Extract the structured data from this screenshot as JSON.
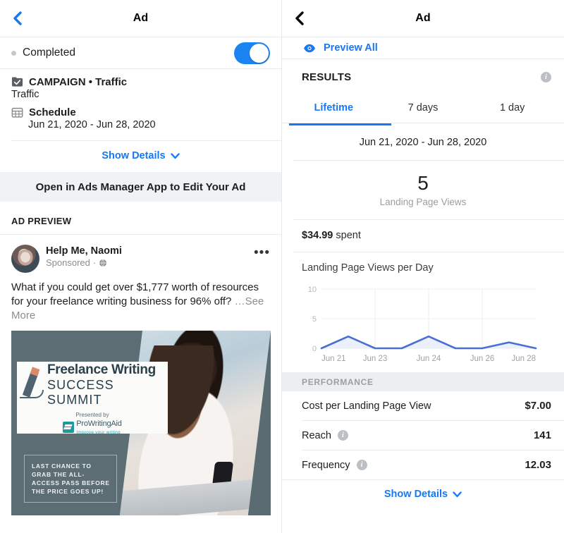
{
  "left": {
    "nav": {
      "title": "Ad",
      "back_icon": "chevron-left-icon"
    },
    "status": {
      "label": "Completed",
      "toggle_on": true,
      "dot_color": "#c4c7cc",
      "toggle_color": "#1b84f3"
    },
    "campaign": {
      "icon": "clipboard-check-icon",
      "title": "CAMPAIGN • Traffic",
      "subtitle": "Traffic"
    },
    "schedule": {
      "icon": "calendar-icon",
      "title": "Schedule",
      "value": "Jun 21, 2020 - Jun 28, 2020"
    },
    "show_details": "Show Details",
    "cta": "Open in Ads Manager App to Edit Your Ad",
    "ad_preview_label": "AD PREVIEW",
    "ad": {
      "page_name": "Help Me, Naomi",
      "sponsored": "Sponsored",
      "globe_icon": "globe-icon",
      "menu_icon": "ellipsis-icon",
      "body": "What if you could get over $1,777 worth of resources for your freelance writing business for 96% off?",
      "see_more": "…See More",
      "creative": {
        "logo_line1": "Freelance Writing",
        "logo_line2": "SUCCESS SUMMIT",
        "presented_by": "Presented by",
        "sponsor_name": "ProWritingAid",
        "sponsor_tagline": "Improve your writing",
        "badge": "LAST CHANCE TO GRAB THE ALL-ACCESS PASS BEFORE THE PRICE GOES UP!"
      }
    }
  },
  "right": {
    "nav": {
      "title": "Ad",
      "back_icon": "chevron-left-icon"
    },
    "preview_all": {
      "label": "Preview All",
      "icon": "eye-icon"
    },
    "results": {
      "title": "RESULTS",
      "info_icon": "info-icon"
    },
    "tabs": [
      {
        "label": "Lifetime",
        "active": true
      },
      {
        "label": "7 days",
        "active": false
      },
      {
        "label": "1 day",
        "active": false
      }
    ],
    "date_range": "Jun 21, 2020 - Jun 28, 2020",
    "headline_metric": {
      "value": "5",
      "label": "Landing Page Views"
    },
    "spend": {
      "amount": "$34.99",
      "suffix": "spent"
    },
    "performance": {
      "header": "PERFORMANCE",
      "rows": [
        {
          "label": "Cost per Landing Page View",
          "value": "$7.00",
          "has_info": false
        },
        {
          "label": "Reach",
          "value": "141",
          "has_info": true,
          "info_icon": "info-icon"
        },
        {
          "label": "Frequency",
          "value": "12.03",
          "has_info": true,
          "info_icon": "info-icon"
        }
      ]
    },
    "show_details": "Show Details",
    "accent_color": "#1878f3"
  },
  "chart_data": {
    "type": "area",
    "title": "Landing Page Views per Day",
    "xlabel": "",
    "ylabel": "",
    "ylim": [
      0,
      10
    ],
    "yticks": [
      0,
      5,
      10
    ],
    "ytick_labels": [
      "0",
      "5",
      "10"
    ],
    "grid": true,
    "legend": "none",
    "x": [
      "Jun 21",
      "Jun 22",
      "Jun 23",
      "Jun 23.5",
      "Jun 24",
      "Jun 25",
      "Jun 26",
      "Jun 27",
      "Jun 28"
    ],
    "xtick_labels": [
      "Jun 21",
      "Jun 23",
      "Jun 24",
      "Jun 26",
      "Jun 28"
    ],
    "values": [
      0,
      2,
      0,
      0,
      2,
      0,
      0,
      1,
      0
    ],
    "line_color": "#4a6fd4",
    "fill_color": "#eaf0fc"
  }
}
